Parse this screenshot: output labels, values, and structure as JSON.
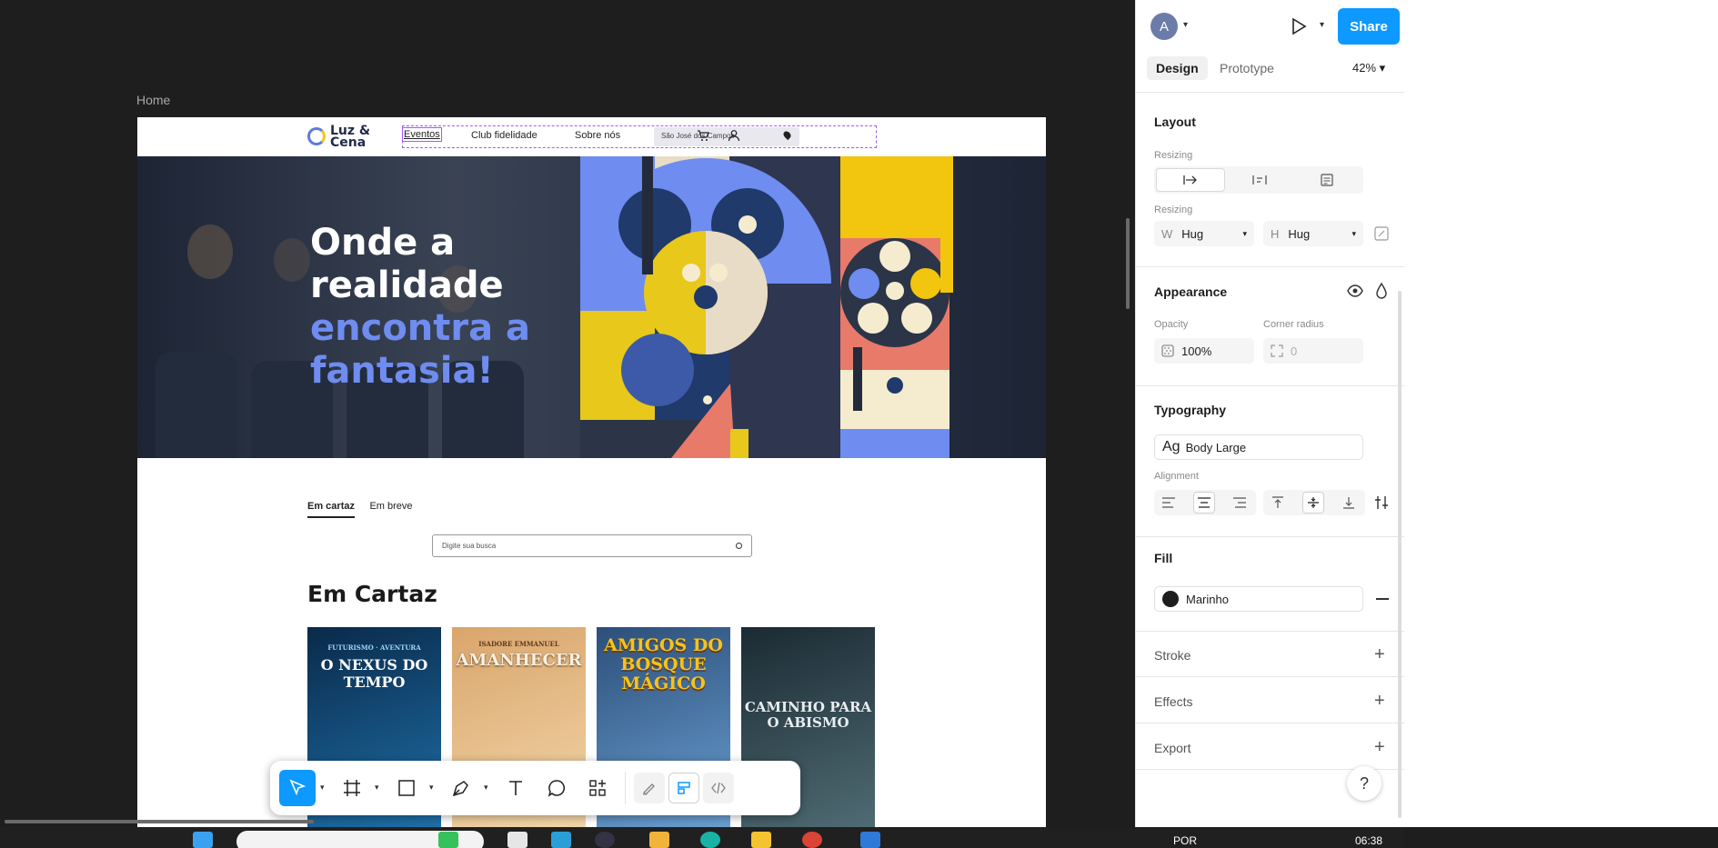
{
  "canvas": {
    "frame_label": "Home",
    "site": {
      "logo_text": "Luz & Cena",
      "nav": [
        "Eventos",
        "Club fidelidade",
        "Sobre nós"
      ],
      "location": "São José dos Campos",
      "hero_lines_white": [
        "Onde a",
        "realidade"
      ],
      "hero_lines_blue": [
        "encontra a",
        "fantasia!"
      ],
      "tabs": [
        "Em cartaz",
        "Em breve"
      ],
      "search_placeholder": "Digite sua busca",
      "section_title": "Em Cartaz",
      "posters": [
        {
          "top": "FUTURISMO · AVENTURA",
          "title": "O NEXUS DO TEMPO",
          "colors": [
            "#0a2a4a",
            "#1e6fa8"
          ]
        },
        {
          "top": "ISADORE EMMANUEL",
          "title": "AMANHECER",
          "colors": [
            "#d9a56c",
            "#f2d6a8"
          ]
        },
        {
          "top": "",
          "title": "AMIGOS DO BOSQUE MÁGICO",
          "colors": [
            "#2c4f7a",
            "#6a9fd1"
          ]
        },
        {
          "top": "",
          "title": "CAMINHO PARA O ABISMO",
          "colors": [
            "#1b2a33",
            "#4f6b73"
          ]
        }
      ]
    }
  },
  "toolbar": {
    "tools": [
      "move-tool",
      "frame-tool",
      "shape-tool",
      "pen-tool",
      "text-tool",
      "comment-tool",
      "actions-tool",
      "draw-mode",
      "design-mode",
      "dev-mode"
    ]
  },
  "panel": {
    "avatar_letter": "A",
    "share_label": "Share",
    "tabs": {
      "design": "Design",
      "prototype": "Prototype"
    },
    "zoom": "42%",
    "layout": {
      "heading": "Layout",
      "resizing_label_1": "Resizing",
      "resizing_label_2": "Resizing",
      "w_label": "W",
      "w_value": "Hug",
      "h_label": "H",
      "h_value": "Hug"
    },
    "appearance": {
      "heading": "Appearance",
      "opacity_label": "Opacity",
      "opacity_value": "100%",
      "radius_label": "Corner radius",
      "radius_value": "0"
    },
    "typography": {
      "heading": "Typography",
      "style_prefix": "Ag",
      "style_name": "Body Large",
      "alignment_label": "Alignment"
    },
    "fill": {
      "heading": "Fill",
      "name": "Marinho",
      "swatch": "#1e1e1e"
    },
    "stroke": "Stroke",
    "effects": "Effects",
    "export": "Export",
    "help": "?"
  },
  "taskbar": {
    "lang": "POR",
    "time": "06:38"
  },
  "colors": {
    "accent": "#0d99ff",
    "selection": "#a259ff",
    "hero_blue": "#6f8cf0"
  }
}
